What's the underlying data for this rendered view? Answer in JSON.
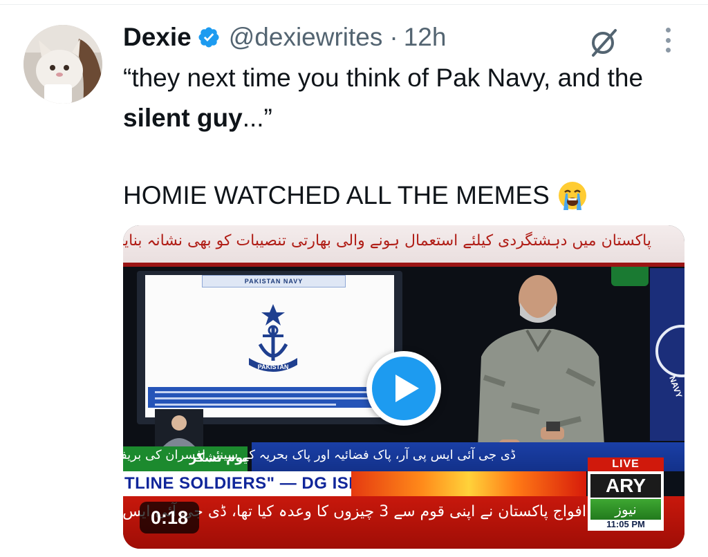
{
  "tweet": {
    "display_name": "Dexie",
    "handle": "@dexiewrites",
    "separator": "·",
    "timestamp": "12h",
    "text_part1": "“they next time you think of Pak Navy, and the ",
    "text_bold": "silent guy",
    "text_part2": "...”",
    "text_line2": "HOMIE WATCHED ALL THE MEMES"
  },
  "icons": {
    "verified": "verified-badge-icon",
    "grok": "grok-icon",
    "more": "more-options-icon",
    "emoji": "loudly-crying-face-emoji"
  },
  "video": {
    "duration": "0:18",
    "banner_top": "پاکستان میں دہشتگردی کیلئے استعمال ہونے والی بھارتی تنصیبات کو بھی نشانہ بنایا، ترجمان",
    "ticker_green": "یوم تشکر",
    "ticker_blue": "ڈی جی آئی ایس پی آر، پاک فضائیہ اور پاک بحریہ کے سینئر افسران کی بریفنگ",
    "ticker_white": "TLINE SOLDIERS\" — DG ISPR",
    "ticker_red": "افواج پاکستان نے اپنی قوم سے 3 چیزوں کا وعدہ کیا تھا، ڈی جی آئی ایس",
    "live_label": "LIVE",
    "channel_logo": "ARY",
    "channel_sub": "نیوز",
    "channel_time": "11:05 PM",
    "screen_header": "PAKISTAN NAVY",
    "emblem_label": "PAKISTAN"
  },
  "colors": {
    "verified_blue": "#1d9bf0",
    "text_primary": "#0f1419",
    "text_secondary": "#536471"
  }
}
